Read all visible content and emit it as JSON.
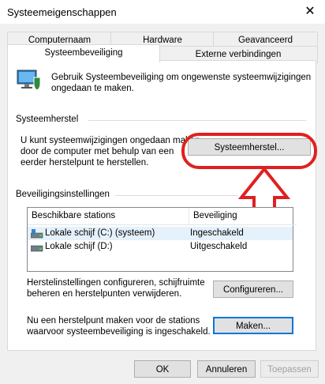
{
  "window": {
    "title": "Systeemeigenschappen"
  },
  "tabs_row1": [
    {
      "label": "Computernaam"
    },
    {
      "label": "Hardware"
    },
    {
      "label": "Geavanceerd"
    }
  ],
  "tabs_row2": [
    {
      "label": "Systeembeveiliging"
    },
    {
      "label": "Externe verbindingen"
    }
  ],
  "intro_text_line1": "Gebruik Systeembeveiliging om ongewenste systeemwijzigingen",
  "intro_text_line2": "ongedaan te maken.",
  "restore_group": {
    "title": "Systeemherstel",
    "line1": "U kunt systeemwijzigingen ongedaan maken",
    "line2": "door de computer met behulp van een",
    "line3": "eerder herstelpunt te herstellen.",
    "button": "Systeemherstel..."
  },
  "protection_group": {
    "title": "Beveiligingsinstellingen",
    "columns": [
      "Beschikbare stations",
      "Beveiliging"
    ],
    "rows": [
      {
        "drive": "Lokale schijf (C:) (systeem)",
        "status": "Ingeschakeld"
      },
      {
        "drive": "Lokale schijf (D:)",
        "status": "Uitgeschakeld"
      }
    ]
  },
  "configure": {
    "line1": "Herstelinstellingen configureren, schijfruimte",
    "line2": "beheren en herstelpunten verwijderen.",
    "button": "Configureren..."
  },
  "create": {
    "line1": "Nu een herstelpunt maken voor de stations",
    "line2": "waarvoor systeembeveiliging is ingeschakeld.",
    "button": "Maken..."
  },
  "footer": {
    "ok": "OK",
    "cancel": "Annuleren",
    "apply": "Toepassen"
  },
  "colors": {
    "annotation": "#e02020",
    "accent": "#0078d7"
  }
}
